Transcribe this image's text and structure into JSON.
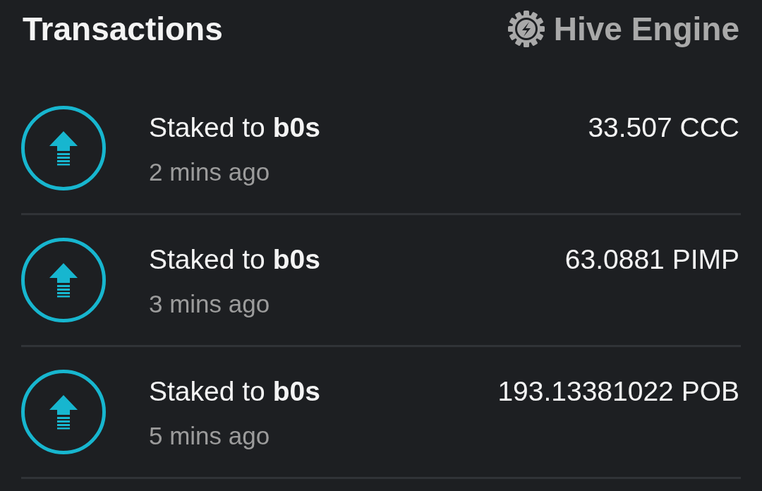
{
  "header": {
    "title": "Transactions",
    "brand": "Hive Engine"
  },
  "transactions": [
    {
      "description": "Staked to **b0s**",
      "time": "2 mins ago",
      "amount": "33.507 CCC"
    },
    {
      "description": "Staked to **b0s**",
      "time": "3 mins ago",
      "amount": "63.0881 PIMP"
    },
    {
      "description": "Staked to **b0s**",
      "time": "5 mins ago",
      "amount": "193.13381022 POB"
    }
  ]
}
